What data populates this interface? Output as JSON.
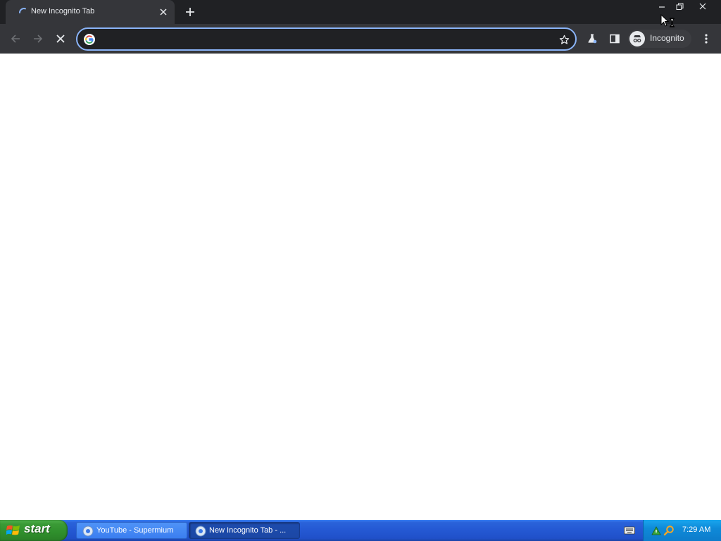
{
  "browser": {
    "tab": {
      "title": "New Incognito Tab",
      "loading": true
    },
    "omnibox": {
      "value": "",
      "placeholder": ""
    },
    "profile": {
      "label": "Incognito"
    },
    "colors": {
      "titlebar": "#202124",
      "toolbar": "#35363a",
      "focus_ring": "#8ab4f8"
    }
  },
  "icons": {
    "tab": [
      "loading-spinner-icon",
      "close-icon"
    ],
    "toolbar": [
      "back-arrow-icon",
      "forward-arrow-icon",
      "stop-loading-icon",
      "google-icon",
      "star-icon",
      "labs-flask-icon",
      "side-panel-icon",
      "incognito-icon",
      "kebab-menu-icon"
    ],
    "window": [
      "minimize-icon",
      "restore-icon",
      "close-icon"
    ]
  },
  "taskbar": {
    "start_label": "start",
    "tasks": [
      {
        "label": "YouTube - Supermium",
        "active": false
      },
      {
        "label": "New Incognito Tab - ...",
        "active": true
      }
    ],
    "clock": "7:29 AM"
  }
}
